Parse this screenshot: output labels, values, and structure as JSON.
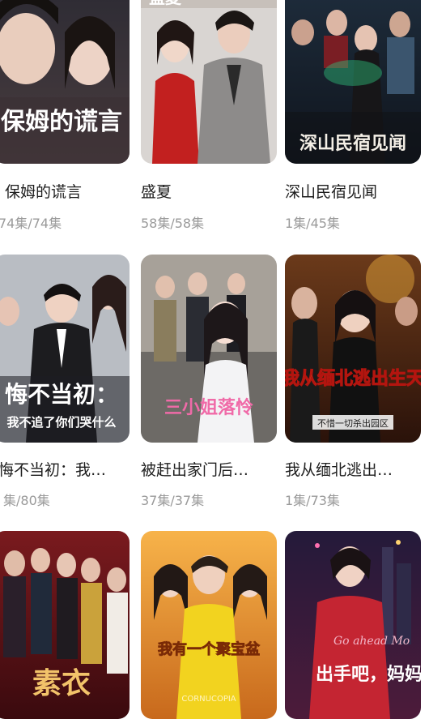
{
  "dramas": [
    {
      "title": "保姆的谎言",
      "episodes": "74集/74集",
      "poster_text": "保姆的谎言"
    },
    {
      "title": "盛夏",
      "episodes": "58集/58集",
      "poster_text": "盛夏"
    },
    {
      "title": "深山民宿见闻",
      "episodes": "1集/45集",
      "poster_text": "深山民宿见闻"
    },
    {
      "title": "悔不当初：我…",
      "episodes": "集/80集",
      "poster_text": "悔不当初：",
      "poster_subtext": "我不追了你们哭什么"
    },
    {
      "title": "被赶出家门后…",
      "episodes": "37集/37集",
      "poster_text": "三小姐落怜"
    },
    {
      "title": "我从缅北逃出…",
      "episodes": "1集/73集",
      "poster_text": "我从缅北逃出生天",
      "poster_subtext": "不惜一切杀出园区"
    },
    {
      "title": "",
      "episodes": "",
      "poster_text": "素衣"
    },
    {
      "title": "",
      "episodes": "",
      "poster_text": "我有一个聚宝盆",
      "poster_subtext": "CORNUCOPIA"
    },
    {
      "title": "",
      "episodes": "",
      "poster_text": "出手吧，妈妈",
      "poster_subtext": "Go ahead Mo"
    }
  ],
  "colors": {
    "title": "#1e1e1e",
    "episodes": "#9a9a9a",
    "background": "#ffffff"
  }
}
